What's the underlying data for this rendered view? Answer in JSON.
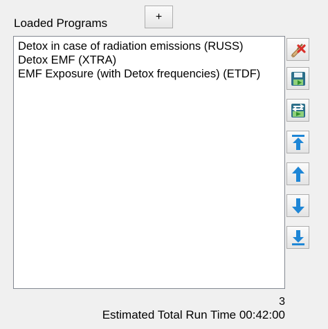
{
  "panel": {
    "title": "Loaded Programs",
    "add_label": "+"
  },
  "programs": [
    "Detox in case of radiation emissions (RUSS)",
    "Detox EMF (XTRA)",
    "EMF Exposure (with Detox frequencies) (ETDF)"
  ],
  "toolbar": [
    {
      "name": "clear-all-button",
      "icon": "broom-red-x-icon"
    },
    {
      "name": "save-button",
      "icon": "floppy-disk-icon"
    },
    {
      "name": "save-as-button",
      "icon": "floppy-disk-arrows-icon"
    },
    {
      "name": "move-to-top-button",
      "icon": "arrow-top-icon"
    },
    {
      "name": "move-up-button",
      "icon": "arrow-up-icon"
    },
    {
      "name": "move-down-button",
      "icon": "arrow-down-icon"
    },
    {
      "name": "move-to-bottom-button",
      "icon": "arrow-bottom-icon"
    }
  ],
  "footer": {
    "count": "3",
    "runtime": "Estimated Total Run Time 00:42:00"
  },
  "colors": {
    "arrow_blue": "#1e86d6",
    "disk_teal": "#2c6f8a",
    "disk_green": "#4caf3a",
    "delete_red": "#d9302a"
  }
}
